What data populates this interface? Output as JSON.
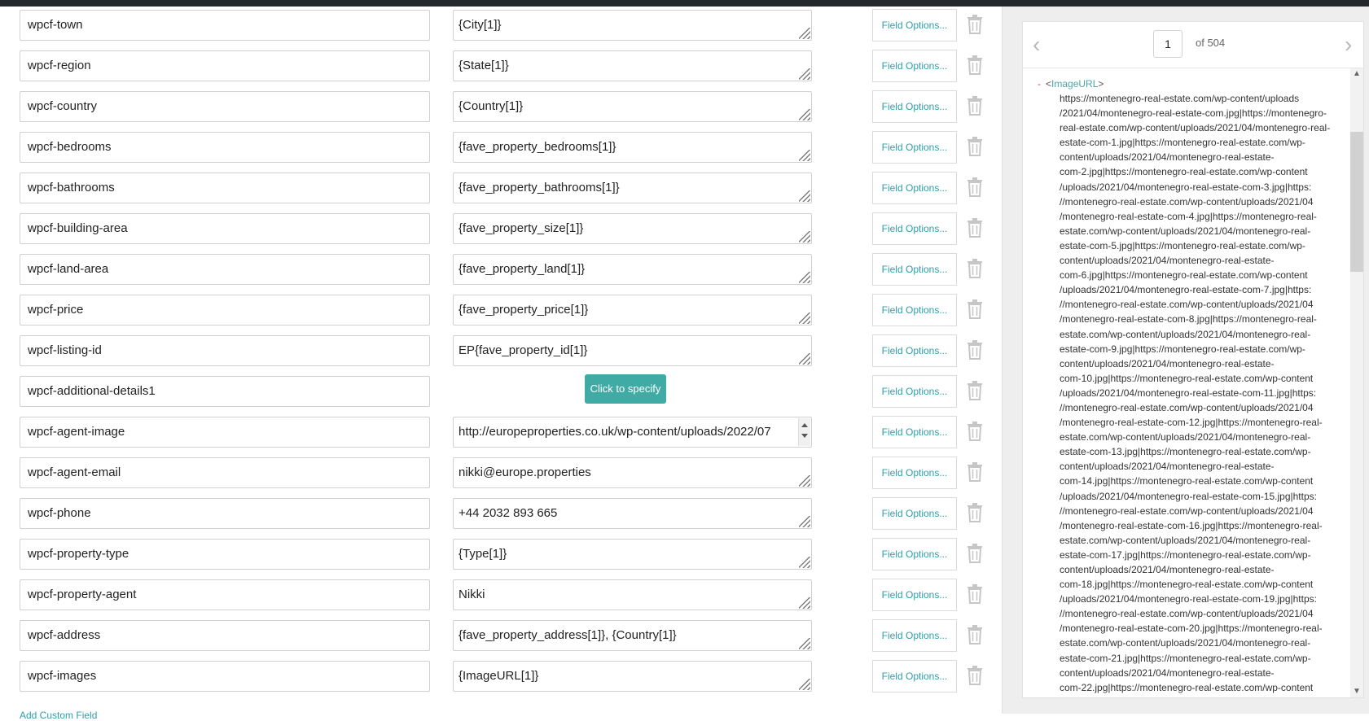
{
  "fields": [
    {
      "name": "wpcf-town",
      "value": "{City[1]}"
    },
    {
      "name": "wpcf-region",
      "value": "{State[1]}"
    },
    {
      "name": "wpcf-country",
      "value": "{Country[1]}"
    },
    {
      "name": "wpcf-bedrooms",
      "value": "{fave_property_bedrooms[1]}"
    },
    {
      "name": "wpcf-bathrooms",
      "value": "{fave_property_bathrooms[1]}"
    },
    {
      "name": "wpcf-building-area",
      "value": "{fave_property_size[1]}"
    },
    {
      "name": "wpcf-land-area",
      "value": "{fave_property_land[1]}"
    },
    {
      "name": "wpcf-price",
      "value": "{fave_property_price[1]}"
    },
    {
      "name": "wpcf-listing-id",
      "value": "EP{fave_property_id[1]}"
    },
    {
      "name": "wpcf-additional-details1",
      "value": "",
      "specify_label": "Click to specify"
    },
    {
      "name": "wpcf-agent-image",
      "value": "http://europeproperties.co.uk/wp-content/uploads/2022/07"
    },
    {
      "name": "wpcf-agent-email",
      "value": "nikki@europe.properties"
    },
    {
      "name": "wpcf-phone",
      "value": "+44 2032 893 665"
    },
    {
      "name": "wpcf-property-type",
      "value": "{Type[1]}"
    },
    {
      "name": "wpcf-property-agent",
      "value": "Nikki"
    },
    {
      "name": "wpcf-address",
      "value": "{fave_property_address[1]}, {Country[1]}"
    },
    {
      "name": "wpcf-images",
      "value": "{ImageURL[1]}"
    }
  ],
  "field_options_label": "Field Options...",
  "add_custom_field_label": "Add Custom Field",
  "preview": {
    "page_number": "1",
    "page_of": "of 504",
    "prev_icon": "chevron-left-icon",
    "next_icon": "chevron-right-icon",
    "xml_tag": "ImageURL",
    "xml_lines": [
      "https://montenegro-real-estate.com/wp-content/uploads",
      "/2021/04/montenegro-real-estate-com.jpg|https://montenegro-",
      "real-estate.com/wp-content/uploads/2021/04/montenegro-real-",
      "estate-com-1.jpg|https://montenegro-real-estate.com/wp-",
      "content/uploads/2021/04/montenegro-real-estate-",
      "com-2.jpg|https://montenegro-real-estate.com/wp-content",
      "/uploads/2021/04/montenegro-real-estate-com-3.jpg|https:",
      "//montenegro-real-estate.com/wp-content/uploads/2021/04",
      "/montenegro-real-estate-com-4.jpg|https://montenegro-real-",
      "estate.com/wp-content/uploads/2021/04/montenegro-real-",
      "estate-com-5.jpg|https://montenegro-real-estate.com/wp-",
      "content/uploads/2021/04/montenegro-real-estate-",
      "com-6.jpg|https://montenegro-real-estate.com/wp-content",
      "/uploads/2021/04/montenegro-real-estate-com-7.jpg|https:",
      "//montenegro-real-estate.com/wp-content/uploads/2021/04",
      "/montenegro-real-estate-com-8.jpg|https://montenegro-real-",
      "estate.com/wp-content/uploads/2021/04/montenegro-real-",
      "estate-com-9.jpg|https://montenegro-real-estate.com/wp-",
      "content/uploads/2021/04/montenegro-real-estate-",
      "com-10.jpg|https://montenegro-real-estate.com/wp-content",
      "/uploads/2021/04/montenegro-real-estate-com-11.jpg|https:",
      "//montenegro-real-estate.com/wp-content/uploads/2021/04",
      "/montenegro-real-estate-com-12.jpg|https://montenegro-real-",
      "estate.com/wp-content/uploads/2021/04/montenegro-real-",
      "estate-com-13.jpg|https://montenegro-real-estate.com/wp-",
      "content/uploads/2021/04/montenegro-real-estate-",
      "com-14.jpg|https://montenegro-real-estate.com/wp-content",
      "/uploads/2021/04/montenegro-real-estate-com-15.jpg|https:",
      "//montenegro-real-estate.com/wp-content/uploads/2021/04",
      "/montenegro-real-estate-com-16.jpg|https://montenegro-real-",
      "estate.com/wp-content/uploads/2021/04/montenegro-real-",
      "estate-com-17.jpg|https://montenegro-real-estate.com/wp-",
      "content/uploads/2021/04/montenegro-real-estate-",
      "com-18.jpg|https://montenegro-real-estate.com/wp-content",
      "/uploads/2021/04/montenegro-real-estate-com-19.jpg|https:",
      "//montenegro-real-estate.com/wp-content/uploads/2021/04",
      "/montenegro-real-estate-com-20.jpg|https://montenegro-real-",
      "estate.com/wp-content/uploads/2021/04/montenegro-real-",
      "estate-com-21.jpg|https://montenegro-real-estate.com/wp-",
      "content/uploads/2021/04/montenegro-real-estate-",
      "com-22.jpg|https://montenegro-real-estate.com/wp-content"
    ]
  },
  "colors": {
    "accent": "#2e9fa8",
    "specify_button": "#40aaa5",
    "xml_tag": "#4aa7a3",
    "xml_dash": "#e04545",
    "panel_bg": "#eeeeee",
    "topbar": "#23282d"
  }
}
